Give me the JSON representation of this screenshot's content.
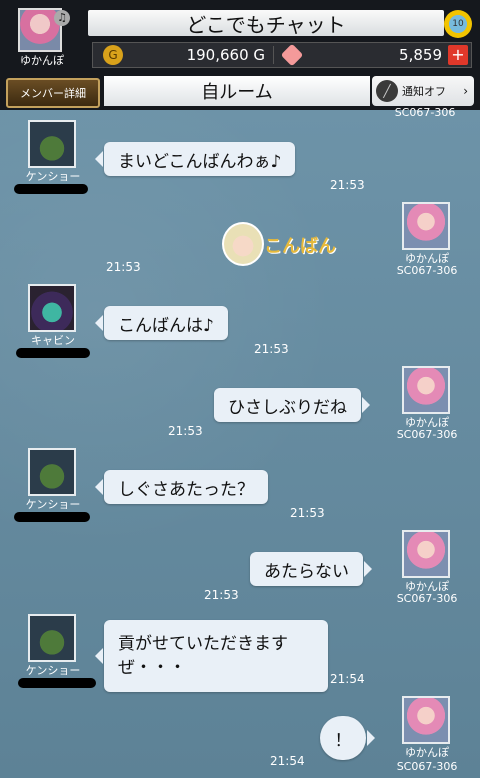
{
  "header": {
    "title": "どこでもチャット",
    "user_name": "ゆかんぽ",
    "gold": "190,660 G",
    "gems": "5,859",
    "gold_icon": "G",
    "plus_label": "+"
  },
  "room_bar": {
    "member_button": "メンバー詳細",
    "room_title": "自ルーム",
    "notify_button": "通知オフ",
    "notify_arrow": "›"
  },
  "messages": [
    {
      "side": "left",
      "name": "ケンショー",
      "text": "まいどこんばんわぁ♪",
      "time": "21:53"
    },
    {
      "side": "right",
      "name": "ゆかんぽ",
      "id": "SC067-306",
      "stamp": "こんばん",
      "time": "21:53"
    },
    {
      "side": "left",
      "name": "キャビン",
      "text": "こんばんは♪",
      "time": "21:53"
    },
    {
      "side": "right",
      "name": "ゆかんぽ",
      "id": "SC067-306",
      "text": "ひさしぶりだね",
      "time": "21:53"
    },
    {
      "side": "left",
      "name": "ケンショー",
      "text": "しぐさあたった？",
      "time": "21:53"
    },
    {
      "side": "right",
      "name": "ゆかんぽ",
      "id": "SC067-306",
      "text": "あたらない",
      "time": "21:53"
    },
    {
      "side": "left",
      "name": "ケンショー",
      "text": "貢がせていただきます\nぜ・・・",
      "time": "21:54"
    },
    {
      "side": "right",
      "name": "ゆかんぽ",
      "id": "SC067-306",
      "text": "！",
      "time": "21:54"
    }
  ],
  "top_partial_id": "SC067-306"
}
